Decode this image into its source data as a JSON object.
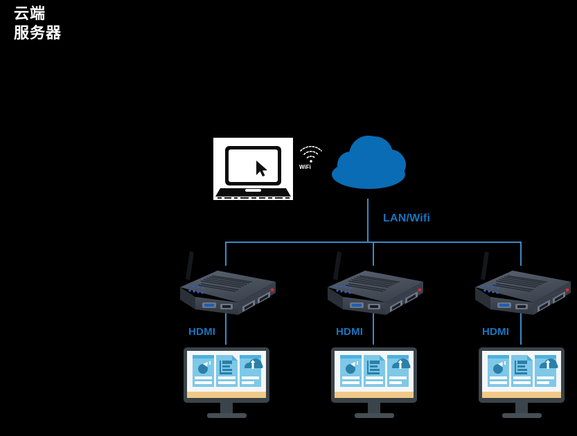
{
  "diagram": {
    "title": "云端\n服务器",
    "background_color": "#000000",
    "accent_blue": "#1675c0",
    "link_blue": "#3f89c8",
    "cloud_color": "#0a6cb4",
    "labels": {
      "lan_wifi": "LAN/Wifi",
      "wifi_tag": "WiFi",
      "hdmi": "HDMI"
    },
    "nodes": {
      "laptop": {
        "name": "laptop",
        "icon": "laptop-icon"
      },
      "wifi": {
        "name": "wifi",
        "icon": "wifi-icon"
      },
      "cloud": {
        "name": "cloud-server",
        "icon": "cloud-icon"
      }
    },
    "branches": [
      {
        "id": "branch-1",
        "device_label": "HDMI",
        "device": "mini-pc",
        "display": "monitor"
      },
      {
        "id": "branch-2",
        "device_label": "HDMI",
        "device": "mini-pc",
        "display": "monitor"
      },
      {
        "id": "branch-3",
        "device_label": "HDMI",
        "device": "mini-pc",
        "display": "monitor"
      }
    ],
    "screen_cards": [
      {
        "icon": "media-play-icon"
      },
      {
        "icon": "document-icon"
      },
      {
        "icon": "cloud-upload-icon"
      }
    ]
  }
}
